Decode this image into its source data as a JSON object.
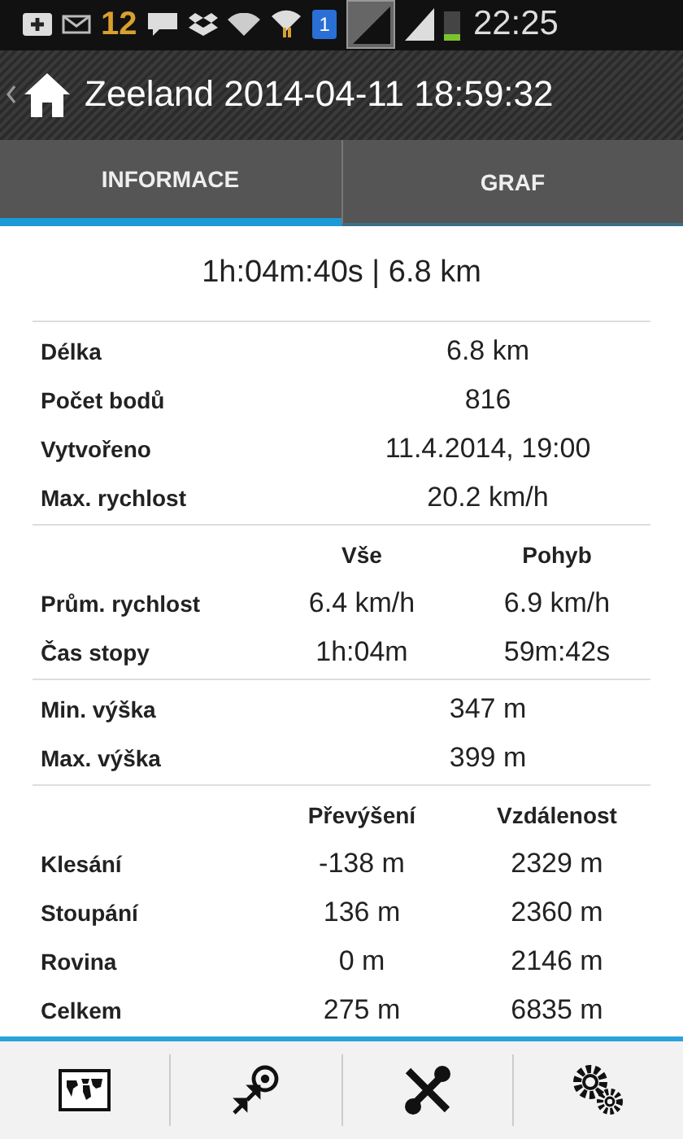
{
  "status_bar": {
    "notification_count": "12",
    "sim_number": "1",
    "time": "22:25"
  },
  "action_bar": {
    "title": "Zeeland 2014-04-11 18:59:32"
  },
  "tabs": [
    {
      "label": "INFORMACE",
      "selected": true
    },
    {
      "label": "GRAF",
      "selected": false
    }
  ],
  "summary": "1h:04m:40s | 6.8 km",
  "sections": [
    {
      "kind": "single",
      "rows": [
        {
          "label": "Délka",
          "value": "6.8 km"
        },
        {
          "label": "Počet bodů",
          "value": "816"
        },
        {
          "label": "Vytvořeno",
          "value": "11.4.2014, 19:00"
        },
        {
          "label": "Max. rychlost",
          "value": "20.2 km/h"
        }
      ]
    },
    {
      "kind": "double",
      "columns": [
        "Vše",
        "Pohyb"
      ],
      "rows": [
        {
          "label": "Prům. rychlost",
          "values": [
            "6.4 km/h",
            "6.9 km/h"
          ]
        },
        {
          "label": "Čas stopy",
          "values": [
            "1h:04m",
            "59m:42s"
          ]
        }
      ]
    },
    {
      "kind": "single",
      "rows": [
        {
          "label": "Min. výška",
          "value": "347 m"
        },
        {
          "label": "Max. výška",
          "value": "399 m"
        }
      ]
    },
    {
      "kind": "double",
      "columns": [
        "Převýšení",
        "Vzdálenost"
      ],
      "rows": [
        {
          "label": "Klesání",
          "values": [
            "-138 m",
            "2329 m"
          ]
        },
        {
          "label": "Stoupání",
          "values": [
            "136 m",
            "2360 m"
          ]
        },
        {
          "label": "Rovina",
          "values": [
            "0 m",
            "2146 m"
          ]
        },
        {
          "label": "Celkem",
          "values": [
            "275 m",
            "6835 m"
          ]
        }
      ]
    }
  ]
}
